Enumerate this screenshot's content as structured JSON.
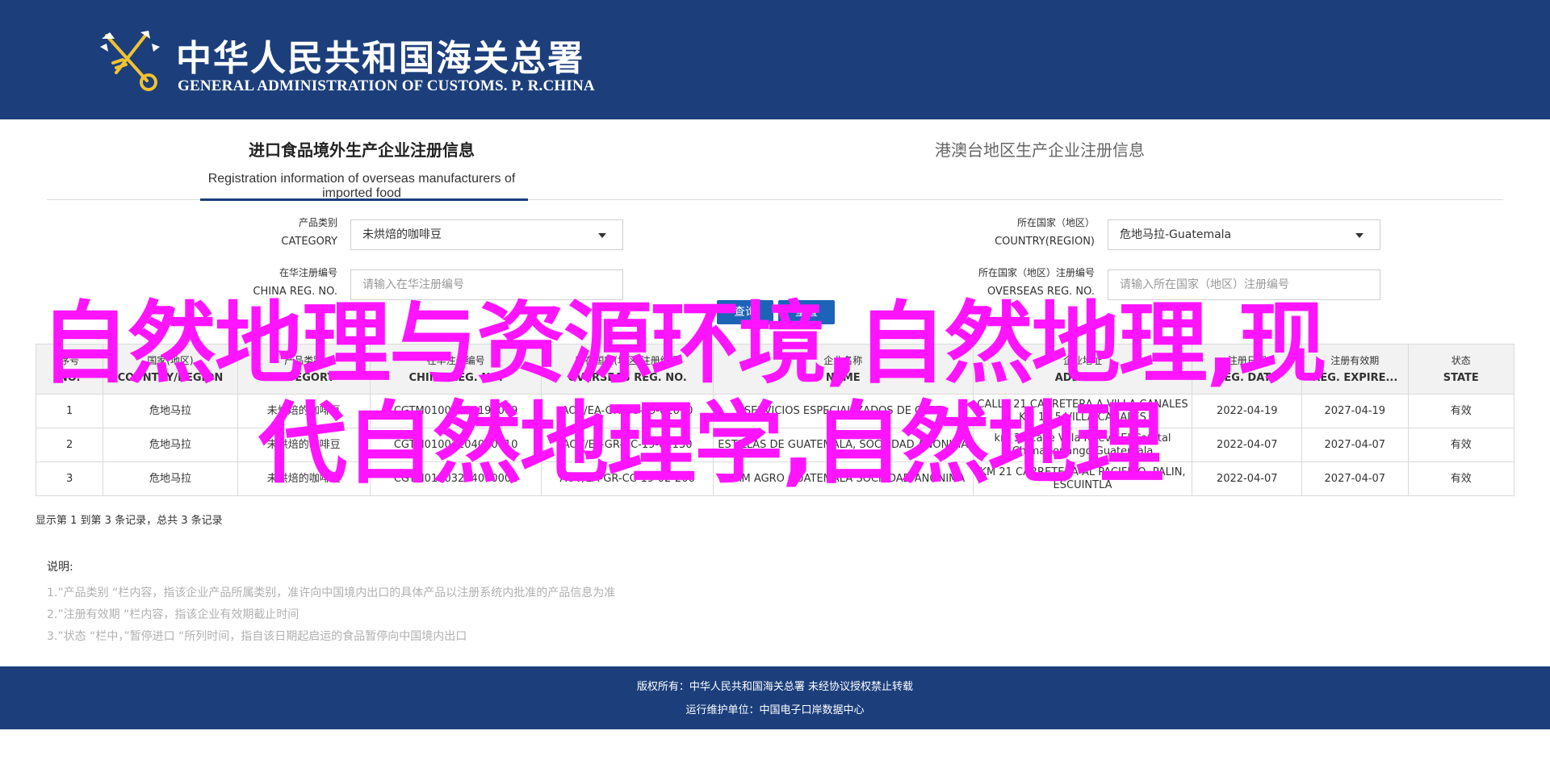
{
  "header": {
    "title_cn": "中华人民共和国海关总署",
    "title_en": "GENERAL ADMINISTRATION OF CUSTOMS. P. R.CHINA",
    "emblem_icon": "customs-emblem-icon"
  },
  "tabs": [
    {
      "label_cn": "进口食品境外生产企业注册信息",
      "label_en": "Registration information of overseas manufacturers of imported food",
      "active": true
    },
    {
      "label_cn": "港澳台地区生产企业注册信息",
      "label_en": "",
      "active": false
    }
  ],
  "form": {
    "category": {
      "label_cn": "产品类别",
      "label_en": "CATEGORY",
      "value": "未烘焙的咖啡豆"
    },
    "country": {
      "label_cn": "所在国家（地区）",
      "label_en": "COUNTRY(REGION)",
      "value": "危地马拉-Guatemala"
    },
    "china_reg": {
      "label_cn": "在华注册编号",
      "label_en": "CHINA REG. NO.",
      "placeholder": "请输入在华注册编号"
    },
    "overseas_reg": {
      "label_cn": "所在国家（地区）注册编号",
      "label_en": "OVERSEAS REG. NO.",
      "placeholder": "请输入所在国家（地区）注册编号"
    }
  },
  "buttons": {
    "search": "查询",
    "reset": "重置"
  },
  "table": {
    "columns": [
      {
        "cn": "序号",
        "en": "NO."
      },
      {
        "cn": "国家(地区)",
        "en": "COUNTRY/REGION"
      },
      {
        "cn": "产品类别",
        "en": "CATEGORY"
      },
      {
        "cn": "在华注册编号",
        "en": "CHINA REG. NO."
      },
      {
        "cn": "所在国家(地区)注册编号",
        "en": "OVERSEAS REG. NO."
      },
      {
        "cn": "企业名称",
        "en": "NAME"
      },
      {
        "cn": "企业地址",
        "en": "ADDRESS"
      },
      {
        "cn": "注册日期",
        "en": "REG. DATE"
      },
      {
        "cn": "注册有效期",
        "en": "REG. EXPIRE..."
      },
      {
        "cn": "状态",
        "en": "STATE"
      }
    ],
    "rows": [
      [
        "1",
        "危地马拉",
        "未烘焙的咖啡豆",
        "CGTM01003204190009",
        "AOV/EA-GR-CC-19-01070",
        "SERVICIOS ESPECIALIZADOS DE CAFE",
        "CALLE 21 CARRETERA A VILLA CANALES KM 14.5 VILLA CANALES",
        "2022-04-19",
        "2027-04-19",
        "有效"
      ],
      [
        "2",
        "危地马拉",
        "未烘焙的咖啡豆",
        "CGTM01003204070010",
        "AOV/ET-GR-CC-19-01130",
        "ESTILLAS DE GUATEMALA, SOCIEDAD ANONIMA",
        "km 35 calle Villa Nueva El Cafetal Chimaltenango Guatemala",
        "2022-04-07",
        "2027-04-07",
        "有效"
      ],
      [
        "3",
        "危地马拉",
        "未烘焙的咖啡豆",
        "CGTM01003204070002",
        "AOV/EA-GR-CC-19-02-206",
        "ALAM AGRO GUATEMALA SOCIEDAD ANONIMA",
        "KM 21 CARRETERA AL PACIFICO, PALIN, ESCUINTLA",
        "2022-04-07",
        "2027-04-07",
        "有效"
      ]
    ]
  },
  "summary": "显示第 1 到第 3 条记录，总共 3 条记录",
  "notes": {
    "title": "说明:",
    "items": [
      "1.”产品类别 “栏内容，指该企业产品所属类别，准许向中国境内出口的具体产品以注册系统内批准的产品信息为准",
      "2.”注册有效期 “栏内容，指该企业有效期截止时间",
      "3.”状态 “栏中，”暂停进口 “所列时间，指自该日期起启运的食品暂停向中国境内出口"
    ]
  },
  "footer": {
    "line1": "版权所有：中华人民共和国海关总署 未经协议授权禁止转载",
    "line2": "运行维护单位：中国电子口岸数据中心"
  },
  "watermark": {
    "line1": "自然地理与资源环境,自然地理,现",
    "line2": "代自然地理学,自然地理"
  },
  "colors": {
    "header_bg": "#1c3f7c",
    "button_bg": "#1c64b8",
    "watermark": "#ff14ff"
  }
}
